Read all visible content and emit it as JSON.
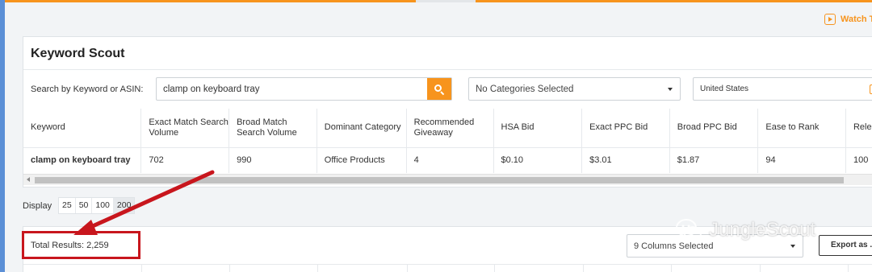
{
  "header": {
    "watch_label": "Watch T"
  },
  "panel": {
    "title": "Keyword Scout",
    "search_label": "Search by Keyword or ASIN:",
    "search_value": "clamp on keyboard tray",
    "category_value": "No Categories Selected",
    "country_value": "United States"
  },
  "table": {
    "columns": [
      "Keyword",
      "Exact Match Search Volume",
      "Broad Match Search Volume",
      "Dominant Category",
      "Recommended Giveaway",
      "HSA Bid",
      "Exact PPC Bid",
      "Broad PPC Bid",
      "Ease to Rank",
      "Rele"
    ],
    "rows": [
      [
        "clamp on keyboard tray",
        "702",
        "990",
        "Office Products",
        "4",
        "$0.10",
        "$3.01",
        "$1.87",
        "94",
        "100"
      ]
    ]
  },
  "pagination": {
    "display_label": "Display",
    "options": [
      "25",
      "50",
      "100",
      "200"
    ],
    "selected": "200"
  },
  "results": {
    "total_label": "Total Results: 2,259",
    "columns_selected": "9 Columns Selected",
    "export_label": "Export as .C"
  },
  "watermark": {
    "text": "JungleScout"
  },
  "colors": {
    "accent": "#f7941d",
    "annotation": "#c8161d"
  }
}
